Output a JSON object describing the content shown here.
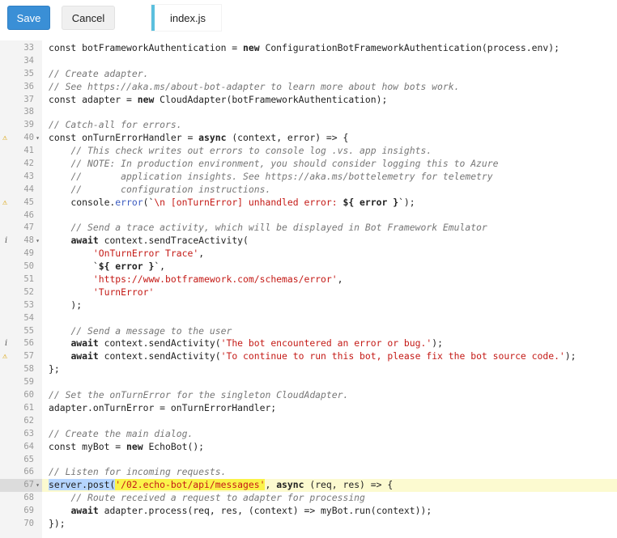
{
  "toolbar": {
    "save_label": "Save",
    "cancel_label": "Cancel",
    "file_tab": "index.js"
  },
  "colors": {
    "save_button": "#3a8fd6",
    "tab_accent": "#5bc0de",
    "warning_icon": "#d9a000",
    "string": "#c41a16",
    "comment": "#777777",
    "active_line": "#fcfad0"
  },
  "editor": {
    "active_line": 67,
    "lines": [
      {
        "n": "33",
        "code": [
          {
            "t": "const botFrameworkAuthentication = "
          },
          {
            "t": "new",
            "c": "kw"
          },
          {
            "t": " ConfigurationBotFrameworkAuthentication(process.env);"
          }
        ]
      },
      {
        "n": "34",
        "code": []
      },
      {
        "n": "35",
        "code": [
          {
            "t": "// Create adapter.",
            "c": "cmt"
          }
        ]
      },
      {
        "n": "36",
        "code": [
          {
            "t": "// See https://aka.ms/about-bot-adapter to learn more about how bots work.",
            "c": "cmt"
          }
        ]
      },
      {
        "n": "37",
        "code": [
          {
            "t": "const adapter = "
          },
          {
            "t": "new",
            "c": "kw"
          },
          {
            "t": " CloudAdapter(botFrameworkAuthentication);"
          }
        ]
      },
      {
        "n": "38",
        "code": []
      },
      {
        "n": "39",
        "code": [
          {
            "t": "// Catch-all for errors.",
            "c": "cmt"
          }
        ]
      },
      {
        "n": "40",
        "marker": "warning",
        "fold": true,
        "code": [
          {
            "t": "const onTurnErrorHandler = "
          },
          {
            "t": "async",
            "c": "kw"
          },
          {
            "t": " (context, error) => {"
          }
        ]
      },
      {
        "n": "41",
        "code": [
          {
            "t": "    "
          },
          {
            "t": "// This check writes out errors to console log .vs. app insights.",
            "c": "cmt"
          }
        ]
      },
      {
        "n": "42",
        "code": [
          {
            "t": "    "
          },
          {
            "t": "// NOTE: In production environment, you should consider logging this to Azure",
            "c": "cmt"
          }
        ]
      },
      {
        "n": "43",
        "code": [
          {
            "t": "    "
          },
          {
            "t": "//       application insights. See https://aka.ms/bottelemetry for telemetry",
            "c": "cmt"
          }
        ]
      },
      {
        "n": "44",
        "code": [
          {
            "t": "    "
          },
          {
            "t": "//       configuration instructions.",
            "c": "cmt"
          }
        ]
      },
      {
        "n": "45",
        "marker": "warning",
        "code": [
          {
            "t": "    console."
          },
          {
            "t": "error",
            "c": "fn"
          },
          {
            "t": "(`"
          },
          {
            "t": "\\n [onTurnError] unhandled error: ",
            "c": "str"
          },
          {
            "t": "${ error }",
            "c": "kw"
          },
          {
            "t": "`);"
          }
        ]
      },
      {
        "n": "46",
        "code": []
      },
      {
        "n": "47",
        "code": [
          {
            "t": "    "
          },
          {
            "t": "// Send a trace activity, which will be displayed in Bot Framework Emulator",
            "c": "cmt"
          }
        ]
      },
      {
        "n": "48",
        "marker": "info",
        "fold": true,
        "code": [
          {
            "t": "    "
          },
          {
            "t": "await",
            "c": "kw"
          },
          {
            "t": " context.sendTraceActivity("
          }
        ]
      },
      {
        "n": "49",
        "code": [
          {
            "t": "        "
          },
          {
            "t": "'OnTurnError Trace'",
            "c": "str"
          },
          {
            "t": ","
          }
        ]
      },
      {
        "n": "50",
        "code": [
          {
            "t": "        `"
          },
          {
            "t": "${ error }",
            "c": "kw"
          },
          {
            "t": "`,"
          }
        ]
      },
      {
        "n": "51",
        "code": [
          {
            "t": "        "
          },
          {
            "t": "'https://www.botframework.com/schemas/error'",
            "c": "str"
          },
          {
            "t": ","
          }
        ]
      },
      {
        "n": "52",
        "code": [
          {
            "t": "        "
          },
          {
            "t": "'TurnError'",
            "c": "str"
          }
        ]
      },
      {
        "n": "53",
        "code": [
          {
            "t": "    );"
          }
        ]
      },
      {
        "n": "54",
        "code": []
      },
      {
        "n": "55",
        "code": [
          {
            "t": "    "
          },
          {
            "t": "// Send a message to the user",
            "c": "cmt"
          }
        ]
      },
      {
        "n": "56",
        "marker": "info",
        "code": [
          {
            "t": "    "
          },
          {
            "t": "await",
            "c": "kw"
          },
          {
            "t": " context.sendActivity("
          },
          {
            "t": "'The bot encountered an error or bug.'",
            "c": "str"
          },
          {
            "t": ");"
          }
        ]
      },
      {
        "n": "57",
        "marker": "warning",
        "code": [
          {
            "t": "    "
          },
          {
            "t": "await",
            "c": "kw"
          },
          {
            "t": " context.sendActivity("
          },
          {
            "t": "'To continue to run this bot, please fix the bot source code.'",
            "c": "str"
          },
          {
            "t": ");"
          }
        ]
      },
      {
        "n": "58",
        "code": [
          {
            "t": "};"
          }
        ]
      },
      {
        "n": "59",
        "code": []
      },
      {
        "n": "60",
        "code": [
          {
            "t": "// Set the onTurnError for the singleton CloudAdapter.",
            "c": "cmt"
          }
        ]
      },
      {
        "n": "61",
        "code": [
          {
            "t": "adapter.onTurnError = onTurnErrorHandler;"
          }
        ]
      },
      {
        "n": "62",
        "code": []
      },
      {
        "n": "63",
        "code": [
          {
            "t": "// Create the main dialog.",
            "c": "cmt"
          }
        ]
      },
      {
        "n": "64",
        "code": [
          {
            "t": "const myBot = "
          },
          {
            "t": "new",
            "c": "kw"
          },
          {
            "t": " EchoBot();"
          }
        ]
      },
      {
        "n": "65",
        "code": []
      },
      {
        "n": "66",
        "code": [
          {
            "t": "// Listen for incoming requests.",
            "c": "cmt"
          }
        ]
      },
      {
        "n": "67",
        "fold": true,
        "active": true,
        "code": [
          {
            "t": "server.post(",
            "c": "sel",
            "cursor": true
          },
          {
            "t": "'/02.echo-bot/api/messages'",
            "c": "hlstr"
          },
          {
            "t": ", "
          },
          {
            "t": "async",
            "c": "kw"
          },
          {
            "t": " (req, res) => {"
          }
        ]
      },
      {
        "n": "68",
        "code": [
          {
            "t": "    "
          },
          {
            "t": "// Route received a request to adapter for processing",
            "c": "cmt"
          }
        ]
      },
      {
        "n": "69",
        "code": [
          {
            "t": "    "
          },
          {
            "t": "await",
            "c": "kw"
          },
          {
            "t": " adapter.process(req, res, (context) => myBot.run(context));"
          }
        ]
      },
      {
        "n": "70",
        "code": [
          {
            "t": "});"
          }
        ]
      }
    ]
  }
}
